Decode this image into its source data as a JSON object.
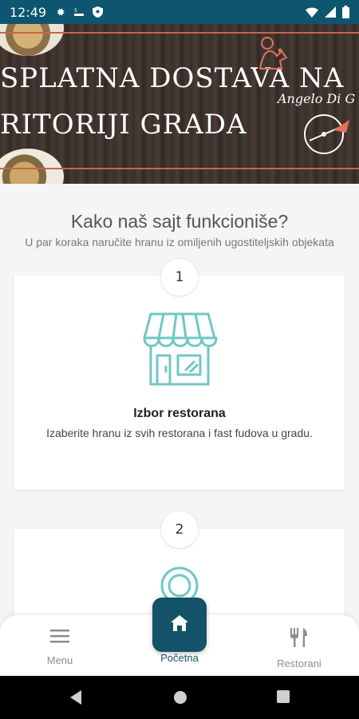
{
  "status_bar": {
    "time": "12:49",
    "icons_left": [
      "gear-icon",
      "sim-icon",
      "shield-icon"
    ],
    "icons_right": [
      "wifi-icon",
      "signal-icon",
      "battery-icon"
    ],
    "color": "#0d5570"
  },
  "banner": {
    "line1": "SPLATNA DOSTAVA NA",
    "line2": "RITORIJI GRADA",
    "brand": "Angelo Di G"
  },
  "section": {
    "title": "Kako naš sajt funkcioniše?",
    "subtitle": "U par koraka naručite hranu iz omiljenih ugostiteljskih objekata"
  },
  "steps": [
    {
      "number": "1",
      "icon": "storefront-icon",
      "title": "Izbor restorana",
      "text": "Izaberite hranu iz svih restorana i fast fudova u gradu."
    },
    {
      "number": "2",
      "icon": "plate-icon"
    }
  ],
  "bottom_nav": {
    "menu_label": "Menu",
    "home_label": "Početna",
    "restaurants_label": "Restorani",
    "accent": "#14526a"
  },
  "colors": {
    "icon_teal": "#6fc7c6",
    "banner_stripe": "#c7664a"
  }
}
